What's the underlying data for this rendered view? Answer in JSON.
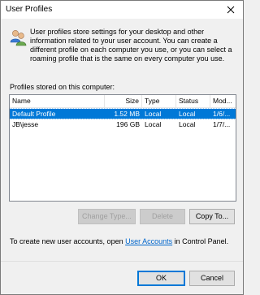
{
  "window": {
    "title": "User Profiles",
    "close_glyph": "✕"
  },
  "description": "User profiles store settings for your desktop and other information related to your user account. You can create a different profile on each computer you use, or you can select a roaming profile that is the same on every computer you use.",
  "profiles": {
    "label": "Profiles stored on this computer:",
    "columns": {
      "name": "Name",
      "size": "Size",
      "type": "Type",
      "status": "Status",
      "modified": "Mod..."
    },
    "rows": [
      {
        "name": "Default Profile",
        "size": "1.52 MB",
        "type": "Local",
        "status": "Local",
        "modified": "1/6/...",
        "selected": true
      },
      {
        "name": "JB\\jesse",
        "size": "196 GB",
        "type": "Local",
        "status": "Local",
        "modified": "1/7/...",
        "selected": false
      }
    ]
  },
  "buttons": {
    "change_type": "Change Type...",
    "delete": "Delete",
    "copy_to": "Copy To...",
    "ok": "OK",
    "cancel": "Cancel"
  },
  "footer": {
    "prefix": "To create new user accounts, open ",
    "link": "User Accounts",
    "suffix": " in Control Panel."
  },
  "colors": {
    "selection": "#0078d7",
    "link": "#0066cc",
    "default_button_border": "#0078d7"
  },
  "icons": {
    "header_icon": "users-icon",
    "close_icon": "close-icon"
  }
}
